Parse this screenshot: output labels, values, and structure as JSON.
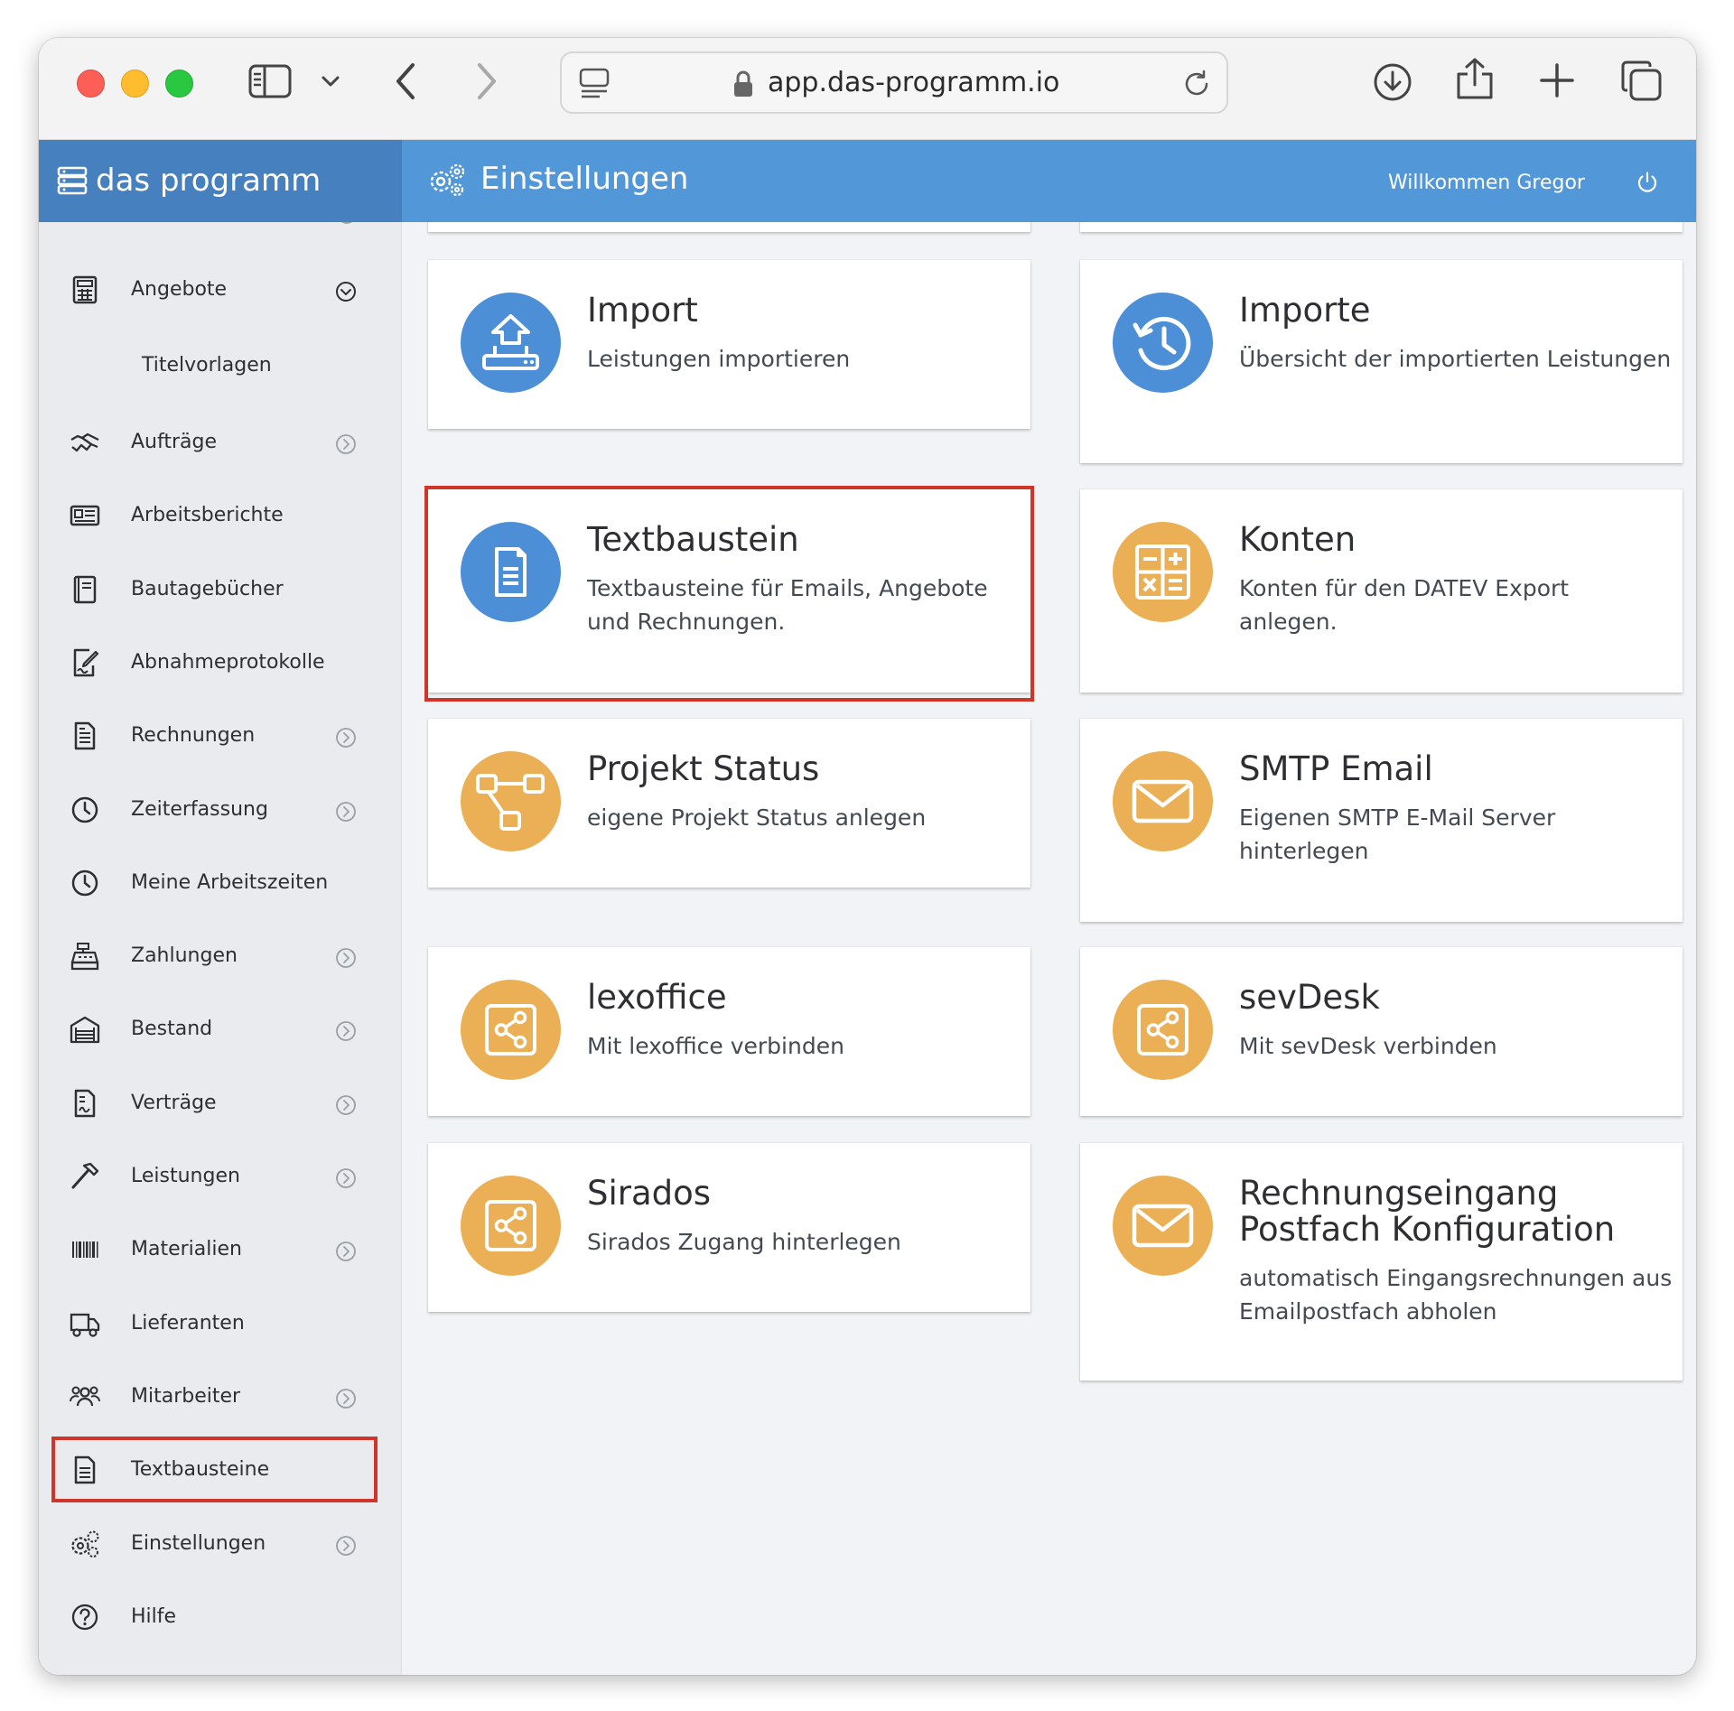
{
  "browser": {
    "url": "app.das-programm.io"
  },
  "header": {
    "brand": "das programm",
    "title": "Einstellungen",
    "welcome": "Willkommen Gregor"
  },
  "sidebar": {
    "items": [
      {
        "label": "Angebote",
        "icon": "calculator-icon",
        "chevron": "expanded"
      },
      {
        "label": "Titelvorlagen",
        "icon": "",
        "chevron": ""
      },
      {
        "label": "Aufträge",
        "icon": "handshake-icon",
        "chevron": "collapsed"
      },
      {
        "label": "Arbeitsberichte",
        "icon": "report-icon",
        "chevron": ""
      },
      {
        "label": "Bautagebücher",
        "icon": "book-icon",
        "chevron": ""
      },
      {
        "label": "Abnahmeprotokolle",
        "icon": "signature-icon",
        "chevron": ""
      },
      {
        "label": "Rechnungen",
        "icon": "invoice-icon",
        "chevron": "collapsed"
      },
      {
        "label": "Zeiterfassung",
        "icon": "clock-icon",
        "chevron": "collapsed"
      },
      {
        "label": "Meine Arbeitszeiten",
        "icon": "clock-icon",
        "chevron": ""
      },
      {
        "label": "Zahlungen",
        "icon": "cash-register-icon",
        "chevron": "collapsed"
      },
      {
        "label": "Bestand",
        "icon": "warehouse-icon",
        "chevron": "collapsed"
      },
      {
        "label": "Verträge",
        "icon": "contract-icon",
        "chevron": "collapsed"
      },
      {
        "label": "Leistungen",
        "icon": "hammer-icon",
        "chevron": "collapsed"
      },
      {
        "label": "Materialien",
        "icon": "barcode-icon",
        "chevron": "collapsed"
      },
      {
        "label": "Lieferanten",
        "icon": "truck-icon",
        "chevron": ""
      },
      {
        "label": "Mitarbeiter",
        "icon": "users-icon",
        "chevron": "collapsed"
      },
      {
        "label": "Textbausteine",
        "icon": "document-icon",
        "chevron": "",
        "highlighted": true
      },
      {
        "label": "Einstellungen",
        "icon": "gears-icon",
        "chevron": "collapsed"
      },
      {
        "label": "Hilfe",
        "icon": "help-icon",
        "chevron": ""
      }
    ]
  },
  "cards": [
    {
      "title": "Import",
      "desc": "Leistungen importieren",
      "icon": "upload-icon",
      "color": "#4d8fd6"
    },
    {
      "title": "Importe",
      "desc": "Übersicht der importierten Leistungen",
      "icon": "history-icon",
      "color": "#4d8fd6"
    },
    {
      "title": "Textbaustein",
      "desc": "Textbausteine für Emails, Angebote und Rechnungen.",
      "icon": "document-icon",
      "color": "#4d8fd6",
      "highlighted": true
    },
    {
      "title": "Konten",
      "desc": "Konten für den DATEV Export anlegen.",
      "icon": "calculator-icon",
      "color": "#ebb055"
    },
    {
      "title": "Projekt Status",
      "desc": "eigene Projekt Status anlegen",
      "icon": "workflow-icon",
      "color": "#ebb055"
    },
    {
      "title": "SMTP Email",
      "desc": "Eigenen SMTP E-Mail Server hinterlegen",
      "icon": "envelope-icon",
      "color": "#ebb055"
    },
    {
      "title": "lexoffice",
      "desc": "Mit lexoffice verbinden",
      "icon": "share-icon",
      "color": "#ebb055"
    },
    {
      "title": "sevDesk",
      "desc": "Mit sevDesk verbinden",
      "icon": "share-icon",
      "color": "#ebb055"
    },
    {
      "title": "Sirados",
      "desc": "Sirados Zugang hinterlegen",
      "icon": "share-icon",
      "color": "#ebb055"
    },
    {
      "title": "Rechnungseingang Postfach Konfiguration",
      "desc": "automatisch Eingangsrechnungen aus Emailpostfach abholen",
      "icon": "envelope-icon",
      "color": "#ebb055"
    }
  ],
  "colors": {
    "brand": "#4680bf",
    "topbar": "#5297d8",
    "accent_blue": "#4d8fd6",
    "accent_orange": "#ebb055",
    "highlight": "#d0352a"
  }
}
